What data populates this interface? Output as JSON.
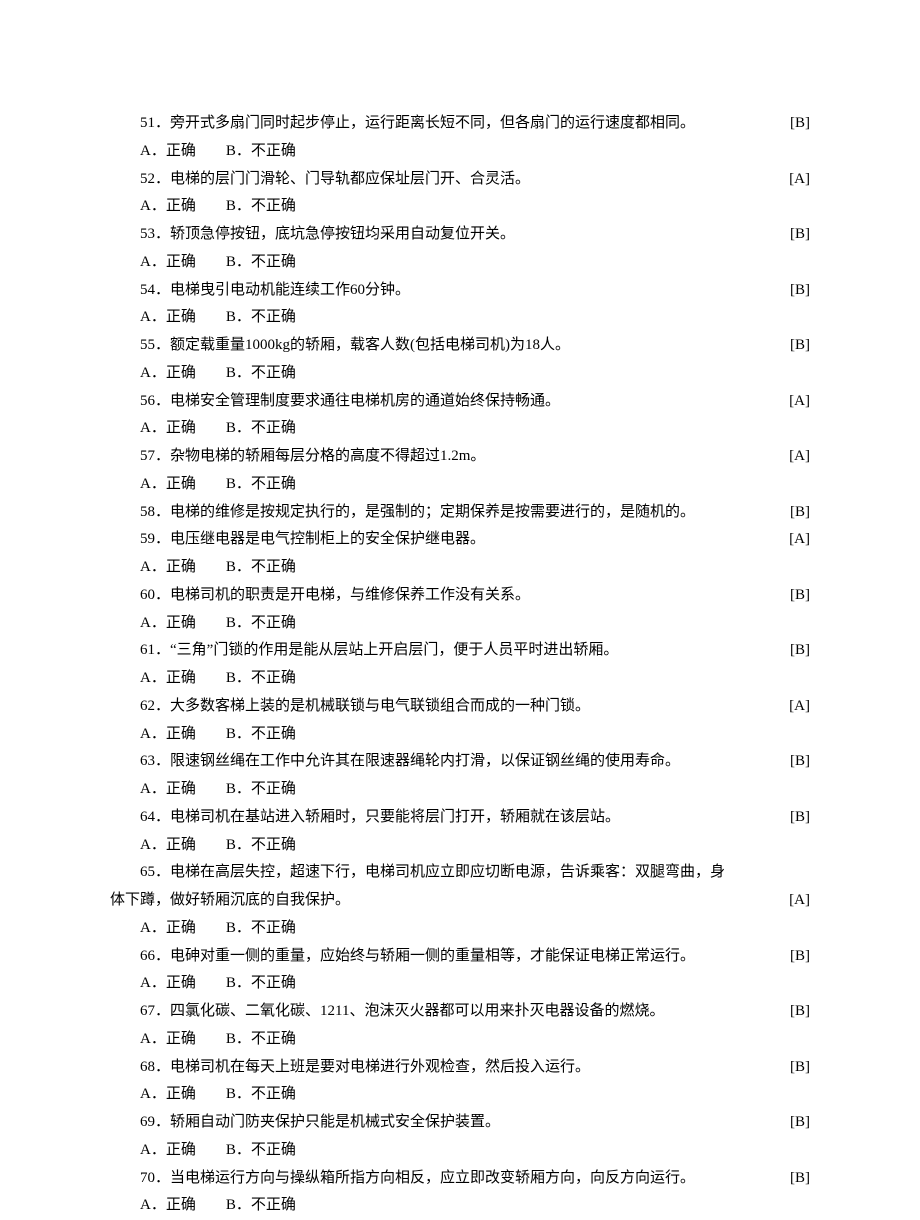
{
  "options": {
    "a": "A．正确",
    "b": "B．不正确"
  },
  "questions": [
    {
      "n": "51",
      "text": "51．旁开式多扇门同时起步停止，运行距离长短不同，但各扇门的运行速度都相同。",
      "ans": "[B]"
    },
    {
      "n": "52",
      "text": "52．电梯的层门门滑轮、门导轨都应保址层门开、合灵活。",
      "ans": "[A]"
    },
    {
      "n": "53",
      "text": "53．轿顶急停按钮，底坑急停按钮均采用自动复位开关。",
      "ans": "[B]"
    },
    {
      "n": "54",
      "text": "54．电梯曳引电动机能连续工作60分钟。",
      "ans": "[B]"
    },
    {
      "n": "55",
      "text": "55．额定载重量1000kg的轿厢，载客人数(包括电梯司机)为18人。",
      "ans": "[B]"
    },
    {
      "n": "56",
      "text": "56．电梯安全管理制度要求通往电梯机房的通道始终保持畅通。",
      "ans": "[A]"
    },
    {
      "n": "57",
      "text": "57．杂物电梯的轿厢每层分格的高度不得超过1.2m。",
      "ans": "[A]"
    },
    {
      "n": "58",
      "text": "58．电梯的维修是按规定执行的，是强制的；定期保养是按需要进行的，是随机的。",
      "ans": "[B]",
      "noOptions": true
    },
    {
      "n": "59",
      "text": "59．电压继电器是电气控制柜上的安全保护继电器。",
      "ans": "[A]"
    },
    {
      "n": "60",
      "text": "60．电梯司机的职责是开电梯，与维修保养工作没有关系。",
      "ans": "[B]"
    },
    {
      "n": "61",
      "text": "61．“三角”门锁的作用是能从层站上开启层门，便于人员平时进出轿厢。",
      "ans": "[B]"
    },
    {
      "n": "62",
      "text": "62．大多数客梯上装的是机械联锁与电气联锁组合而成的一种门锁。",
      "ans": "[A]"
    },
    {
      "n": "63",
      "text": "63．限速钢丝绳在工作中允许其在限速器绳轮内打滑，以保证钢丝绳的使用寿命。",
      "ans": "[B]"
    },
    {
      "n": "64",
      "text": "64．电梯司机在基站进入轿厢时，只要能将层门打开，轿厢就在该层站。",
      "ans": "[B]"
    },
    {
      "n": "65",
      "text": "65．电梯在高层失控，超速下行，电梯司机应立即应切断电源，告诉乘客：双腿弯曲，身",
      "cont": "体下蹲，做好轿厢沉底的自我保护。",
      "ans": "[A]"
    },
    {
      "n": "66",
      "text": "66．电砷对重一侧的重量，应始终与轿厢一侧的重量相等，才能保证电梯正常运行。",
      "ans": "[B]"
    },
    {
      "n": "67",
      "text": "67．四氯化碳、二氧化碳、1211、泡沫灭火器都可以用来扑灭电器设备的燃烧。",
      "ans": "[B]"
    },
    {
      "n": "68",
      "text": "68．电梯司机在每天上班是要对电梯进行外观检查，然后投入运行。",
      "ans": "[B]"
    },
    {
      "n": "69",
      "text": "69．轿厢自动门防夹保护只能是机械式安全保护装置。",
      "ans": "[B]"
    },
    {
      "n": "70",
      "text": "70．当电梯运行方向与操纵箱所指方向相反，应立即改变轿厢方向，向反方向运行。",
      "ans": "[B]"
    }
  ]
}
